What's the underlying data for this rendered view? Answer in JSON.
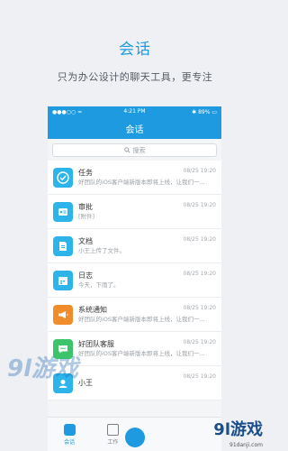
{
  "promo": {
    "title": "会话",
    "subtitle": "只为办公设计的聊天工具，更专注"
  },
  "statusbar": {
    "left": "●●●○○ ≈",
    "time": "4:21 PM",
    "right": "89%"
  },
  "navbar": {
    "title": "会话"
  },
  "search": {
    "placeholder": "搜索"
  },
  "rows": [
    {
      "name": "任务",
      "preview": "好团队的iOS客户端新版本即将上线，让我们一...",
      "time": "08/25 19:20",
      "icon": "check-icon",
      "color": "#2db5e9"
    },
    {
      "name": "审批",
      "preview": "[附件]",
      "time": "08/25 19:20",
      "icon": "approval-icon",
      "color": "#2db5e9"
    },
    {
      "name": "文档",
      "preview": "小王上传了文件。",
      "time": "08/25 19:20",
      "icon": "document-icon",
      "color": "#2db5e9"
    },
    {
      "name": "日志",
      "preview": "今天，下雨了。",
      "time": "08/25 19:20",
      "icon": "calendar-icon",
      "color": "#2db5e9"
    },
    {
      "name": "系统通知",
      "preview": "好团队的iOS客户端新版本即将上线，让我们一...",
      "time": "08/25 19:20",
      "icon": "megaphone-icon",
      "color": "#f08c2a"
    },
    {
      "name": "好团队客服",
      "preview": "好团队的iOS客户端新版本即将上线，让我们一...",
      "time": "08/25 19:20",
      "icon": "chat-icon",
      "color": "#3cc46a"
    },
    {
      "name": "小王",
      "preview": "",
      "time": "08/25 19:20",
      "icon": "avatar-icon",
      "color": "#2db5e9"
    }
  ],
  "tabs": {
    "chat": "会话",
    "work": "工作"
  },
  "watermark": {
    "right_brand": "9l游戏",
    "right_domain": "91danji.com",
    "left_brand": "9l游戏"
  }
}
